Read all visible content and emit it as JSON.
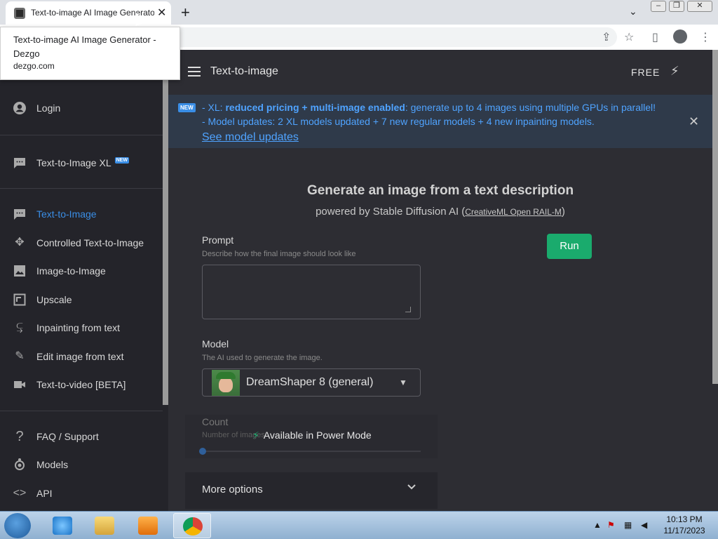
{
  "browser": {
    "tab_title": "Text-to-image AI Image Generator - Dezgo",
    "tab_close": "✕",
    "new_tab": "+",
    "tab_search": "⌄",
    "tooltip_title": "Text-to-image AI Image Generator - Dezgo",
    "tooltip_domain": "dezgo.com",
    "window_controls": [
      "▭",
      "❐",
      "✕"
    ]
  },
  "toolbar": {
    "icons": [
      "share-icon",
      "star-icon",
      "side-panel-icon",
      "profile-icon",
      "menu-icon"
    ],
    "share": "⇪",
    "star": "☆",
    "panel": "▯",
    "menu": "⋮"
  },
  "appbar": {
    "title": "Text-to-image",
    "free_label": "FREE",
    "bolt": "⚡"
  },
  "sidebar": {
    "login": "Login",
    "items_top": [
      {
        "label": "Text-to-Image XL",
        "badge": "NEW",
        "icon": "chat-icon"
      }
    ],
    "items_main": [
      {
        "label": "Text-to-Image",
        "icon": "chat-icon",
        "active": true
      },
      {
        "label": "Controlled Text-to-Image",
        "icon": "move-icon"
      },
      {
        "label": "Image-to-Image",
        "icon": "image-icon"
      },
      {
        "label": "Upscale",
        "icon": "upscale-icon"
      },
      {
        "label": "Inpainting from text",
        "icon": "wrap-icon"
      },
      {
        "label": "Edit image from text",
        "icon": "edit-icon"
      },
      {
        "label": "Text-to-video [BETA]",
        "icon": "video-icon"
      }
    ],
    "items_bottom": [
      {
        "label": "FAQ / Support",
        "icon": "help-icon"
      },
      {
        "label": "Models",
        "icon": "models-icon"
      },
      {
        "label": "API",
        "icon": "code-icon"
      }
    ]
  },
  "banner": {
    "badge": "NEW",
    "line1_prefix": "- XL: ",
    "line1_bold": "reduced pricing + multi-image enabled",
    "line1_suffix": ": generate up to 4 images using multiple GPUs in parallel!",
    "line2": "- Model updates: 2 XL models updated + 7 new regular models + 4 new inpainting models.",
    "link": "See model updates",
    "close": "✕"
  },
  "main": {
    "heading": "Generate an image from a text description",
    "subheading_prefix": "powered by Stable Diffusion AI (",
    "license_link": "CreativeML Open RAIL-M",
    "subheading_suffix": ")",
    "prompt_label": "Prompt",
    "prompt_hint": "Describe how the final image should look like",
    "prompt_value": "",
    "run_button": "Run",
    "model_label": "Model",
    "model_hint": "The AI used to generate the image.",
    "model_selected": "DreamShaper 8 (general)",
    "count_label": "Count",
    "count_hint": "Number of images",
    "power_mode": "Available in Power Mode",
    "more_options": "More options"
  },
  "taskbar": {
    "clock_time": "10:13 PM",
    "clock_date": "11/17/2023",
    "apps": [
      "internet-explorer-icon",
      "file-explorer-icon",
      "media-player-icon",
      "chrome-icon"
    ]
  },
  "colors": {
    "accent": "#3a8ee6",
    "run_green": "#1aab6d",
    "sidebar_bg": "#24242a",
    "page_bg": "#2d2d33",
    "banner_text": "#4fa3ff"
  }
}
